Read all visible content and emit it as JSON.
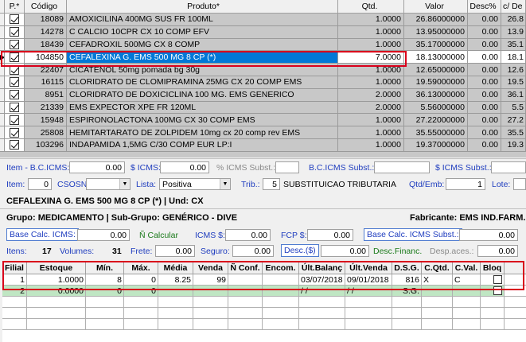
{
  "top_grid": {
    "headers": {
      "p": "P.*",
      "codigo": "Código",
      "produto": "Produto*",
      "qtd": "Qtd.",
      "valor": "Valor",
      "desc": "Desc%",
      "cd": "c/ De"
    },
    "rows": [
      {
        "codigo": "18089",
        "produto": "AMOXICILINA 400MG SUS FR 100ML",
        "qtd": "1.0000",
        "valor": "26.86000000",
        "desc": "0.00",
        "cd": "26.8"
      },
      {
        "codigo": "14278",
        "produto": "C CALCIO 10CPR CX 10 COMP EFV",
        "qtd": "1.0000",
        "valor": "13.95000000",
        "desc": "0.00",
        "cd": "13.9"
      },
      {
        "codigo": "18439",
        "produto": "CEFADROXIL 500MG CX 8 COMP",
        "qtd": "1.0000",
        "valor": "35.17000000",
        "desc": "0.00",
        "cd": "35.1"
      },
      {
        "codigo": "104850",
        "produto": "CEFALEXINA G. EMS 500 MG 8 CP (*)",
        "qtd": "7.0000",
        "valor": "18.13000000",
        "desc": "0.00",
        "cd": "18.1"
      },
      {
        "codigo": "22407",
        "produto": "CICATENOL 50mg pomada bg 30g",
        "qtd": "1.0000",
        "valor": "12.65000000",
        "desc": "0.00",
        "cd": "12.6"
      },
      {
        "codigo": "16115",
        "produto": "CLORIDRATO DE CLOMIPRAMINA 25MG CX 20 COMP EMS",
        "qtd": "1.0000",
        "valor": "19.59000000",
        "desc": "0.00",
        "cd": "19.5"
      },
      {
        "codigo": "8951",
        "produto": "CLORIDRATO DE DOXICICLINA 100 MG. EMS GENERICO",
        "qtd": "2.0000",
        "valor": "36.13000000",
        "desc": "0.00",
        "cd": "36.1"
      },
      {
        "codigo": "21339",
        "produto": "EMS EXPECTOR XPE FR 120ML",
        "qtd": "2.0000",
        "valor": "5.56000000",
        "desc": "0.00",
        "cd": "5.5"
      },
      {
        "codigo": "15948",
        "produto": "ESPIRONOLACTONA 100MG CX 30 COMP EMS",
        "qtd": "1.0000",
        "valor": "27.22000000",
        "desc": "0.00",
        "cd": "27.2"
      },
      {
        "codigo": "25808",
        "produto": "HEMITARTARATO DE ZOLPIDEM 10mg cx 20 comp rev EMS",
        "qtd": "1.0000",
        "valor": "35.55000000",
        "desc": "0.00",
        "cd": "35.5"
      },
      {
        "codigo": "103296",
        "produto": "INDAPAMIDA 1,5MG C/30 COMP EUR LP:I",
        "qtd": "1.0000",
        "valor": "19.37000000",
        "desc": "0.00",
        "cd": "19.3"
      }
    ]
  },
  "detail": {
    "item_bc_icms_label": "Item - B.C.ICMS:",
    "item_bc_icms_value": "0.00",
    "icms_label": "$ ICMS:",
    "icms_value": "0.00",
    "icms_subst_pct_label": "% ICMS Subst.:",
    "bc_icms_subst_label": "B.C.ICMS Subst.:",
    "icms_subst_label": "$ ICMS Subst.:",
    "item_label": "Item:",
    "item_value": "0",
    "csosn_label": "CSOSN:",
    "lista_label": "Lista:",
    "lista_value": "Positiva",
    "trib_label": "Trib.:",
    "trib_value": "5",
    "trib_desc": "SUBSTITUICAO TRIBUTARIA",
    "qtd_emb_label": "Qtd/Emb:",
    "qtd_emb_value": "1",
    "lote_label": "Lote:",
    "product_line": "CEFALEXINA G. EMS 500 MG 8 CP (*) | Und: CX",
    "group_line": "Grupo: MEDICAMENTO | Sub-Grupo: GENÉRICO - DIVE",
    "fabricante_line": "Fabricante: EMS IND.FARM.L",
    "base_calc_icms_label": "Base Calc. ICMS:",
    "base_calc_icms_value": "0.00",
    "calcular_label": "Ñ Calcular",
    "icms_dollar_label": "ICMS $:",
    "icms_dollar_value": "0.00",
    "fcp_label": "FCP $:",
    "fcp_value": "0.00",
    "base_calc_icms_subst_label": "Base Calc. ICMS Subst.:",
    "base_calc_icms_subst_value": "0.00",
    "itens_label": "Itens:",
    "itens_value": "17",
    "volumes_label": "Volumes:",
    "volumes_value": "31",
    "frete_label": "Frete:",
    "frete_value": "0.00",
    "seguro_label": "Seguro:",
    "seguro_value": "0.00",
    "desc_btn_label": "Desc.($)",
    "desc_value": "0.00",
    "desc_financ_label": "Desc.Financ.",
    "desp_aces_label": "Desp.aces.:",
    "desp_aces_value": "0.00"
  },
  "stock_grid": {
    "headers": [
      "Filial",
      "Estoque",
      "Mín.",
      "Máx.",
      "Média",
      "Venda",
      "Ñ Conf.",
      "Encom.",
      "Últ.Balanç",
      "Últ.Venda",
      "D.S.G.",
      "C.Qtd.",
      "C.Val.",
      "Bloq"
    ],
    "rows": [
      [
        "1",
        "1.0000",
        "8",
        "0",
        "8.25",
        "99",
        "",
        "",
        "03/07/2018",
        "09/01/2018",
        "816",
        "X",
        "C",
        ""
      ],
      [
        "2",
        "0.0000",
        "0",
        "0",
        "",
        "",
        "",
        "",
        "/ /",
        "/ /",
        "S.G.",
        "",
        "",
        ""
      ]
    ]
  },
  "colors": {
    "selection": "#0078d7",
    "highlight_border": "#d9001b",
    "label_blue": "#1f3dbf",
    "row_green": "#bfe6c3"
  }
}
